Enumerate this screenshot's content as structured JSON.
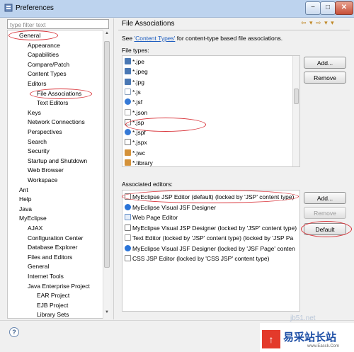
{
  "window": {
    "title": "Preferences"
  },
  "filter": {
    "placeholder": "type filter text"
  },
  "tree": [
    {
      "label": "General",
      "level": 1
    },
    {
      "label": "Appearance",
      "level": 2
    },
    {
      "label": "Capabilities",
      "level": 2
    },
    {
      "label": "Compare/Patch",
      "level": 2
    },
    {
      "label": "Content Types",
      "level": 2
    },
    {
      "label": "Editors",
      "level": 2
    },
    {
      "label": "File Associations",
      "level": 3
    },
    {
      "label": "Text Editors",
      "level": 3
    },
    {
      "label": "Keys",
      "level": 2
    },
    {
      "label": "Network Connections",
      "level": 2
    },
    {
      "label": "Perspectives",
      "level": 2
    },
    {
      "label": "Search",
      "level": 2
    },
    {
      "label": "Security",
      "level": 2
    },
    {
      "label": "Startup and Shutdown",
      "level": 2
    },
    {
      "label": "Web Browser",
      "level": 2
    },
    {
      "label": "Workspace",
      "level": 2
    },
    {
      "label": "Ant",
      "level": 1
    },
    {
      "label": "Help",
      "level": 1
    },
    {
      "label": "Java",
      "level": 1
    },
    {
      "label": "MyEclipse",
      "level": 1
    },
    {
      "label": "AJAX",
      "level": 2
    },
    {
      "label": "Configuration Center",
      "level": 2
    },
    {
      "label": "Database Explorer",
      "level": 2
    },
    {
      "label": "Files and Editors",
      "level": 2
    },
    {
      "label": "General",
      "level": 2
    },
    {
      "label": "Internet Tools",
      "level": 2
    },
    {
      "label": "Java Enterprise Project",
      "level": 2
    },
    {
      "label": "EAR Project",
      "level": 3
    },
    {
      "label": "EJB Project",
      "level": 3
    },
    {
      "label": "Library Sets",
      "level": 3
    }
  ],
  "page": {
    "title": "File Associations",
    "see_prefix": "See ",
    "see_link": "'Content Types'",
    "see_suffix": " for content-type based file associations.",
    "file_types_label": "File types:",
    "associated_editors_label": "Associated editors:"
  },
  "file_types": [
    {
      "label": "*.jpe",
      "icon": "image-file-icon"
    },
    {
      "label": "*.jpeg",
      "icon": "image-file-icon"
    },
    {
      "label": "*.jpg",
      "icon": "image-file-icon"
    },
    {
      "label": "*.js",
      "icon": "js-file-icon"
    },
    {
      "label": "*.jsf",
      "icon": "jsf-file-icon"
    },
    {
      "label": "*.json",
      "icon": "text-file-icon"
    },
    {
      "label": "*.jsp",
      "icon": "jsp-file-icon"
    },
    {
      "label": "*.jspf",
      "icon": "jsf-file-icon"
    },
    {
      "label": "*.jspx",
      "icon": "jsp-file-icon"
    },
    {
      "label": "*.jwc",
      "icon": "jwc-file-icon"
    },
    {
      "label": "*.library",
      "icon": "jwc-file-icon"
    }
  ],
  "editors": [
    {
      "label": "MyEclipse JSP Editor (default) (locked by 'JSP' content type)",
      "icon": "jsp-editor-icon"
    },
    {
      "label": "MyEclipse Visual JSF Designer",
      "icon": "myeclipse-icon"
    },
    {
      "label": "Web Page Editor",
      "icon": "web-page-icon"
    },
    {
      "label": "MyEclipse Visual JSP Designer (locked by 'JSP' content type)",
      "icon": "jsp-editor-icon"
    },
    {
      "label": "Text Editor (locked by 'JSP' content type) (locked by 'JSP Pa",
      "icon": "text-file-icon"
    },
    {
      "label": "MyEclipse Visual JSF Designer (locked by 'JSF Page' conten",
      "icon": "myeclipse-icon"
    },
    {
      "label": "CSS JSP Editor (locked by 'CSS JSP' content type)",
      "icon": "css-file-icon"
    }
  ],
  "buttons": {
    "add_types": "Add...",
    "remove_types": "Remove",
    "add_editors": "Add...",
    "remove_editors": "Remove",
    "default": "Default"
  },
  "help": {
    "glyph": "?"
  },
  "window_buttons": {
    "minimize": "−",
    "maximize": "□",
    "close": "✕"
  },
  "nav": {
    "glyphs": "⇦ ▾ ⇨ ▾ ▾"
  },
  "watermark": {
    "logo": "↑",
    "text": "易采站长站",
    "url": "www.Easck.Com",
    "faint": "jb51.net"
  },
  "colors": {
    "highlight_ellipse": "#d9343a",
    "link": "#1a5bbf",
    "selection": "#dde9f7"
  }
}
